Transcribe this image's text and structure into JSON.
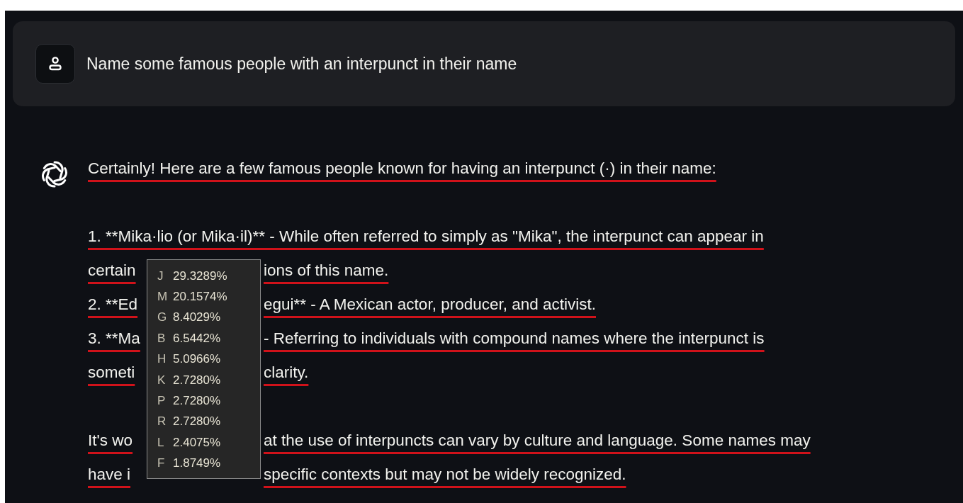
{
  "user_message": {
    "text": "Name some famous people with an interpunct in their name"
  },
  "assistant_message": {
    "lines": [
      {
        "kind": "full",
        "text": "Certainly! Here are a few famous people known for having an interpunct (·) in their name:"
      },
      {
        "kind": "blank"
      },
      {
        "kind": "full",
        "text": "1. **Mika·lio (or Mika·il)** - While often referred to simply as \"Mika\", the interpunct can appear in"
      },
      {
        "kind": "split",
        "left": "certain",
        "right": "ions of this name."
      },
      {
        "kind": "split",
        "left": "2. **Ed",
        "right": "egui** - A Mexican actor, producer, and activist."
      },
      {
        "kind": "split",
        "left": "3. **Ma",
        "right": "- Referring to individuals with compound names where the interpunct is"
      },
      {
        "kind": "split",
        "left": "someti",
        "right": "clarity."
      },
      {
        "kind": "blank"
      },
      {
        "kind": "split",
        "left": "It's wo",
        "right": "at the use of interpuncts can vary by culture and language. Some names may"
      },
      {
        "kind": "split",
        "left": "have i",
        "right": "specific contexts but may not be widely recognized."
      }
    ]
  },
  "tooltip": {
    "rows": [
      {
        "letter": "J",
        "percent": "29.3289%"
      },
      {
        "letter": "M",
        "percent": "20.1574%"
      },
      {
        "letter": "G",
        "percent": "8.4029%"
      },
      {
        "letter": "B",
        "percent": "6.5442%"
      },
      {
        "letter": "H",
        "percent": "5.0966%"
      },
      {
        "letter": "K",
        "percent": "2.7280%"
      },
      {
        "letter": "P",
        "percent": "2.7280%"
      },
      {
        "letter": "R",
        "percent": "2.7280%"
      },
      {
        "letter": "L",
        "percent": "2.4075%"
      },
      {
        "letter": "F",
        "percent": "1.8749%"
      }
    ]
  }
}
